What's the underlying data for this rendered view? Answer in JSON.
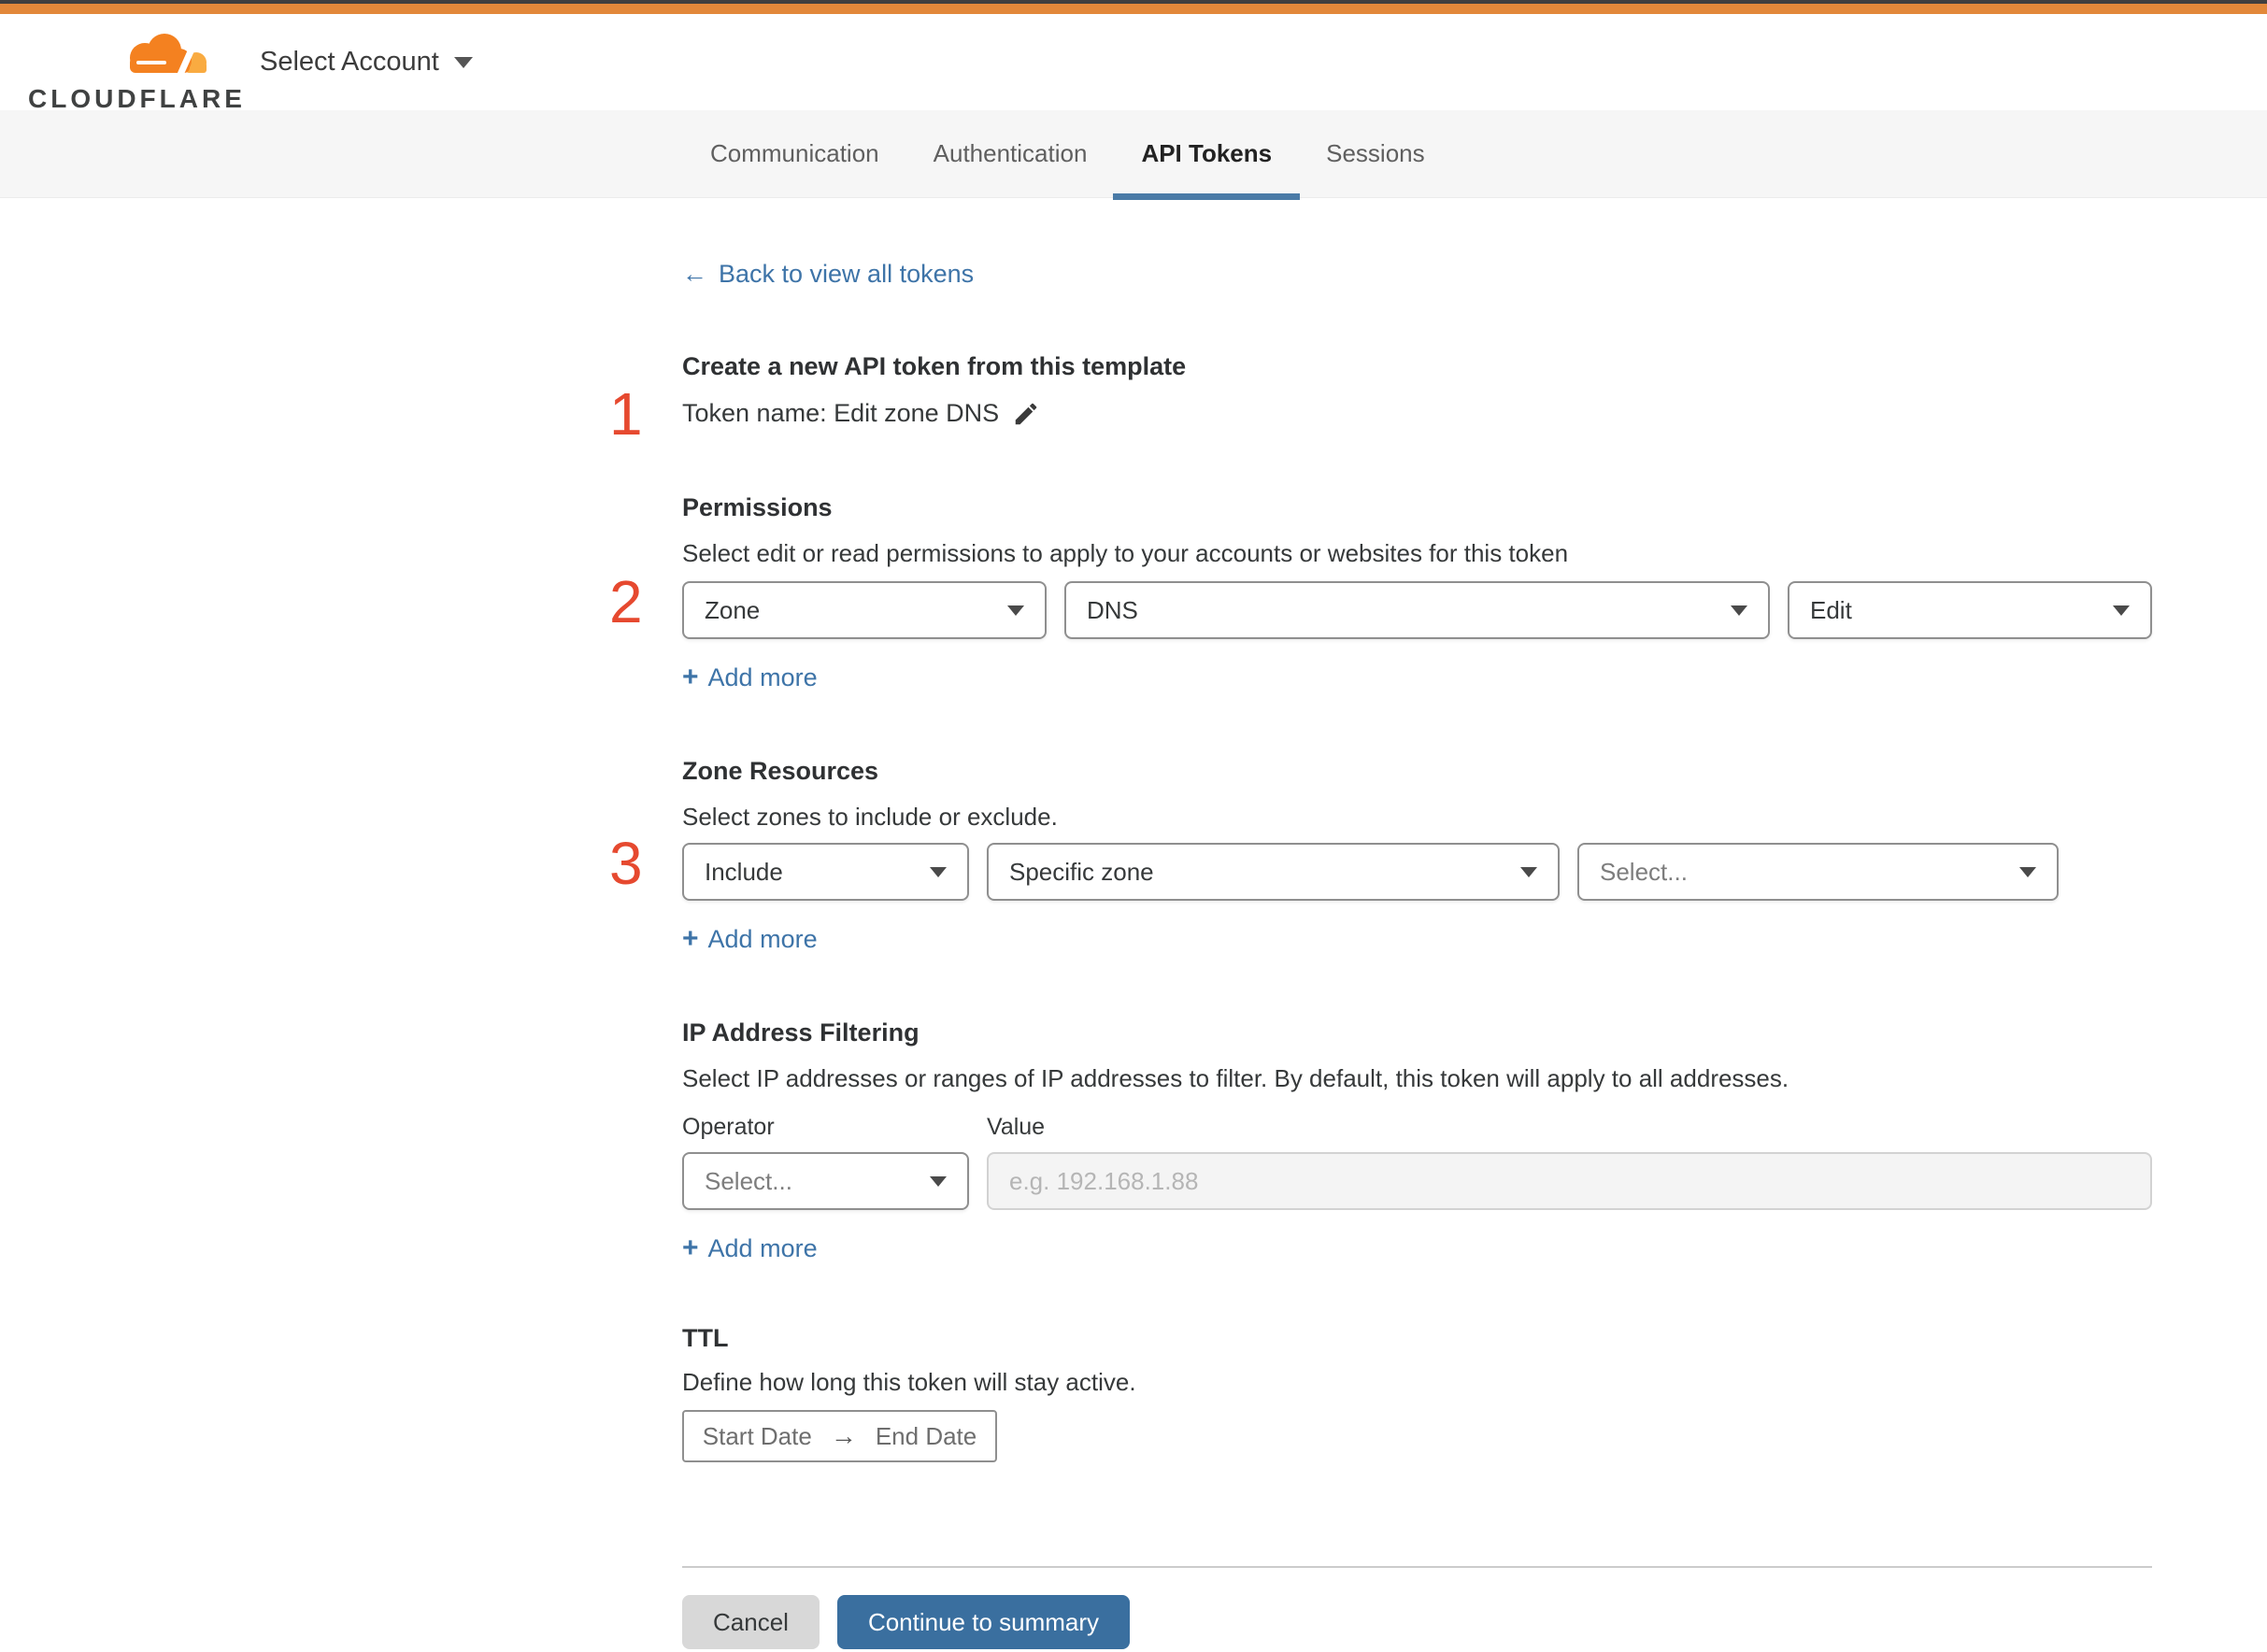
{
  "header": {
    "logo_text": "CLOUDFLARE",
    "account_selector_label": "Select Account"
  },
  "tabs": {
    "items": [
      {
        "label": "Communication",
        "active": false
      },
      {
        "label": "Authentication",
        "active": false
      },
      {
        "label": "API Tokens",
        "active": true
      },
      {
        "label": "Sessions",
        "active": false
      }
    ]
  },
  "back_link": {
    "arrow": "←",
    "label": "Back to view all tokens"
  },
  "sections": {
    "template": {
      "number": "1",
      "title": "Create a new API token from this template",
      "token_name": "Token name: Edit zone DNS"
    },
    "permissions": {
      "number": "2",
      "title": "Permissions",
      "description": "Select edit or read permissions to apply to your accounts or websites for this token",
      "selects": [
        {
          "value": "Zone"
        },
        {
          "value": "DNS"
        },
        {
          "value": "Edit"
        }
      ],
      "add_more": {
        "plus": "+",
        "label": "Add more"
      }
    },
    "zone_resources": {
      "number": "3",
      "title": "Zone Resources",
      "description": "Select zones to include or exclude.",
      "selects": [
        {
          "value": "Include"
        },
        {
          "value": "Specific zone"
        },
        {
          "value": "Select..."
        }
      ],
      "add_more": {
        "plus": "+",
        "label": "Add more"
      }
    },
    "ip_filtering": {
      "title": "IP Address Filtering",
      "description": "Select IP addresses or ranges of IP addresses to filter. By default, this token will apply to all addresses.",
      "operator_label": "Operator",
      "value_label": "Value",
      "operator_select": "Select...",
      "value_placeholder": "e.g. 192.168.1.88",
      "add_more": {
        "plus": "+",
        "label": "Add more"
      }
    },
    "ttl": {
      "title": "TTL",
      "description": "Define how long this token will stay active.",
      "start_date": "Start Date",
      "arrow": "→",
      "end_date": "End Date"
    }
  },
  "footer": {
    "cancel_label": "Cancel",
    "continue_label": "Continue to summary"
  },
  "colors": {
    "accent_orange": "#e2883a",
    "accent_dark": "#3f3f3f",
    "step_red": "#e6492f",
    "link_blue": "#3e74a8",
    "button_blue": "#3a6f9f",
    "tab_underline": "#4a7ba7"
  }
}
